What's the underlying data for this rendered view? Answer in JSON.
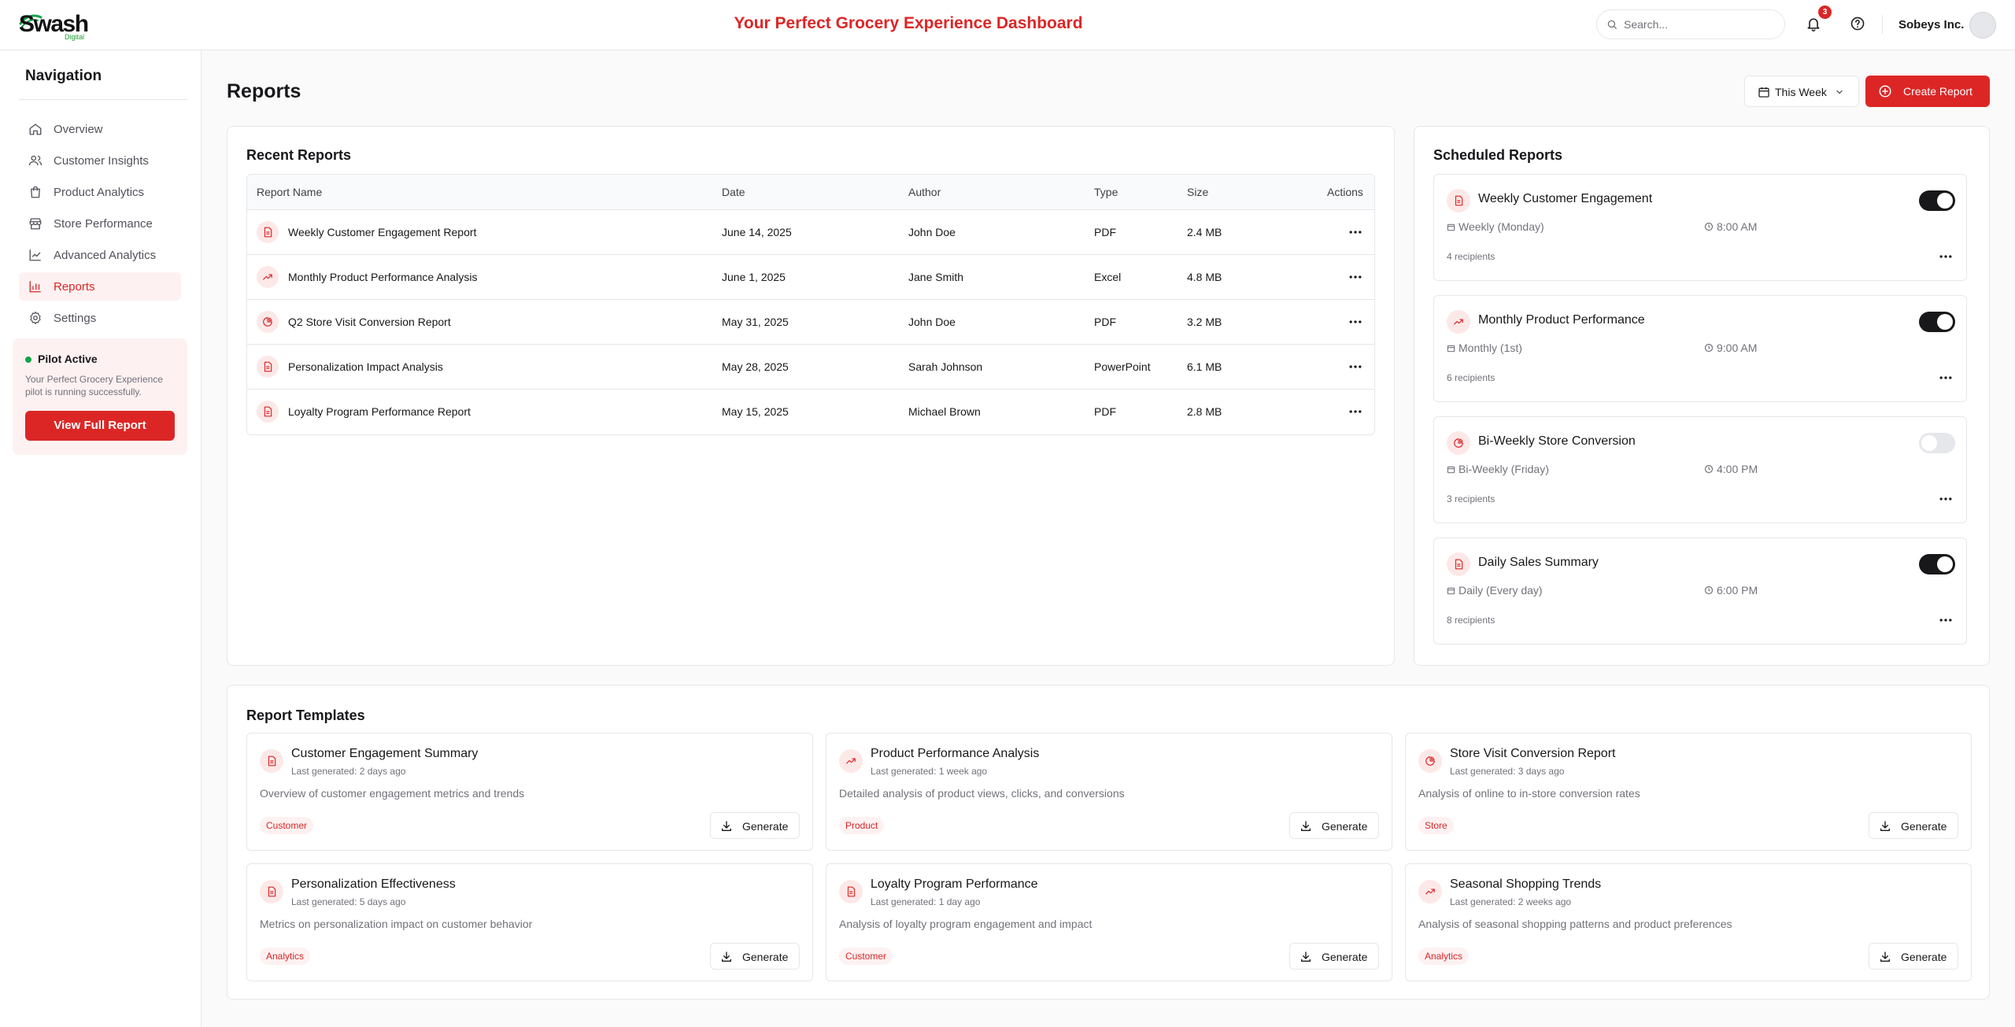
{
  "header": {
    "logo": "Swash",
    "logo_sub": "Digital",
    "title": "Your Perfect Grocery Experience Dashboard",
    "search_placeholder": "Search...",
    "notification_count": "3",
    "company": "Sobeys Inc."
  },
  "sidebar": {
    "heading": "Navigation",
    "items": [
      {
        "label": "Overview",
        "icon": "home-icon"
      },
      {
        "label": "Customer Insights",
        "icon": "users-icon"
      },
      {
        "label": "Product Analytics",
        "icon": "shopping-bag-icon"
      },
      {
        "label": "Store Performance",
        "icon": "store-icon"
      },
      {
        "label": "Advanced Analytics",
        "icon": "line-chart-icon"
      },
      {
        "label": "Reports",
        "icon": "bar-chart-icon",
        "active": true
      },
      {
        "label": "Settings",
        "icon": "gear-icon"
      }
    ],
    "pilot": {
      "title": "Pilot Active",
      "description": "Your Perfect Grocery Experience pilot is running successfully.",
      "button": "View Full Report"
    }
  },
  "main": {
    "title": "Reports",
    "period": "This Week",
    "create_label": "Create Report"
  },
  "recent": {
    "title": "Recent Reports",
    "columns": [
      "Report Name",
      "Date",
      "Author",
      "Type",
      "Size",
      "Actions"
    ],
    "rows": [
      {
        "name": "Weekly Customer Engagement Report",
        "date": "June 14, 2025",
        "author": "John Doe",
        "type": "PDF",
        "size": "2.4 MB",
        "icon": "file-icon"
      },
      {
        "name": "Monthly Product Performance Analysis",
        "date": "June 1, 2025",
        "author": "Jane Smith",
        "type": "Excel",
        "size": "4.8 MB",
        "icon": "trend-icon"
      },
      {
        "name": "Q2 Store Visit Conversion Report",
        "date": "May 31, 2025",
        "author": "John Doe",
        "type": "PDF",
        "size": "3.2 MB",
        "icon": "pie-icon"
      },
      {
        "name": "Personalization Impact Analysis",
        "date": "May 28, 2025",
        "author": "Sarah Johnson",
        "type": "PowerPoint",
        "size": "6.1 MB",
        "icon": "file-icon"
      },
      {
        "name": "Loyalty Program Performance Report",
        "date": "May 15, 2025",
        "author": "Michael Brown",
        "type": "PDF",
        "size": "2.8 MB",
        "icon": "file-icon"
      }
    ]
  },
  "scheduled": {
    "title": "Scheduled Reports",
    "items": [
      {
        "name": "Weekly Customer Engagement",
        "frequency": "Weekly (Monday)",
        "time": "8:00 AM",
        "recipients": "4 recipients",
        "enabled": true,
        "icon": "file-icon"
      },
      {
        "name": "Monthly Product Performance",
        "frequency": "Monthly (1st)",
        "time": "9:00 AM",
        "recipients": "6 recipients",
        "enabled": true,
        "icon": "trend-icon"
      },
      {
        "name": "Bi-Weekly Store Conversion",
        "frequency": "Bi-Weekly (Friday)",
        "time": "4:00 PM",
        "recipients": "3 recipients",
        "enabled": false,
        "icon": "pie-icon"
      },
      {
        "name": "Daily Sales Summary",
        "frequency": "Daily (Every day)",
        "time": "6:00 PM",
        "recipients": "8 recipients",
        "enabled": true,
        "icon": "file-icon"
      }
    ]
  },
  "templates": {
    "title": "Report Templates",
    "generate_label": "Generate",
    "items": [
      {
        "name": "Customer Engagement Summary",
        "last": "Last generated: 2 days ago",
        "desc": "Overview of customer engagement metrics and trends",
        "tag": "Customer",
        "icon": "file-icon"
      },
      {
        "name": "Product Performance Analysis",
        "last": "Last generated: 1 week ago",
        "desc": "Detailed analysis of product views, clicks, and conversions",
        "tag": "Product",
        "icon": "trend-icon"
      },
      {
        "name": "Store Visit Conversion Report",
        "last": "Last generated: 3 days ago",
        "desc": "Analysis of online to in-store conversion rates",
        "tag": "Store",
        "icon": "pie-icon"
      },
      {
        "name": "Personalization Effectiveness",
        "last": "Last generated: 5 days ago",
        "desc": "Metrics on personalization impact on customer behavior",
        "tag": "Analytics",
        "icon": "file-icon"
      },
      {
        "name": "Loyalty Program Performance",
        "last": "Last generated: 1 day ago",
        "desc": "Analysis of loyalty program engagement and impact",
        "tag": "Customer",
        "icon": "file-icon"
      },
      {
        "name": "Seasonal Shopping Trends",
        "last": "Last generated: 2 weeks ago",
        "desc": "Analysis of seasonal shopping patterns and product preferences",
        "tag": "Analytics",
        "icon": "trend-icon"
      }
    ]
  },
  "colors": {
    "accent": "#dc2626",
    "accent_bg": "#fdf1f1",
    "icon_bg": "#fde8e8"
  }
}
